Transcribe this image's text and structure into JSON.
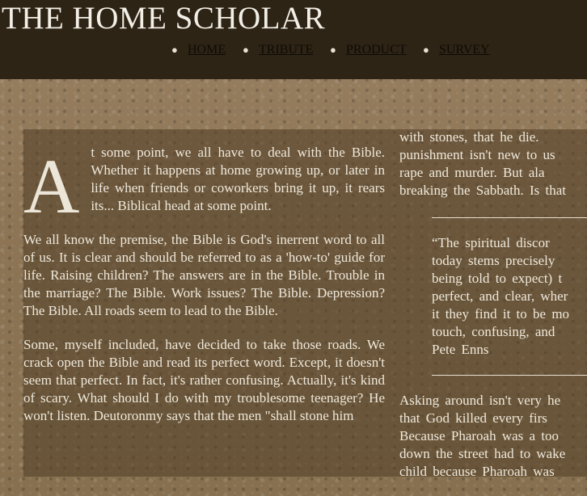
{
  "site": {
    "title": "THE HOME SCHOLAR"
  },
  "nav": [
    {
      "label": "HOME"
    },
    {
      "label": "TRIBUTE"
    },
    {
      "label": "PRODUCT"
    },
    {
      "label": "SURVEY"
    }
  ],
  "article": {
    "dropcap": "A",
    "para1": "t some point, we all have to deal with the Bible. Whether it happens at home growing up, or later in life when friends or coworkers bring it up, it rears its... Biblical head at some point.",
    "para2": "We all know the premise, the Bible is God's inerrent word to all of us. It is clear and should be referred to as a 'how-to' guide for life. Raising children? The answers are in the Bible. Trouble in the marriage? The Bible. Work issues? The Bible. Depression? The Bible. All roads seem to lead to the Bible.",
    "para3": "Some, myself included, have decided to take those roads. We crack open the Bible and read its perfect word. Except, it doesn't seem that perfect. In fact, it's rather confusing. Actually, it's kind of scary. What should I do with my troublesome teenager? He won't listen. Deutoronmy says that the men \"shall stone him",
    "col2_lines": [
      "with stones, that he die.",
      "punishment isn't new to us",
      "rape and murder. But ala",
      "breaking the Sabbath. Is that"
    ],
    "quote_lines": [
      "“The spiritual discor",
      "today stems precisely",
      "being told to expect) t",
      "perfect, and clear, wher",
      "it they find it to be mo",
      "touch, confusing, and",
      "Pete Enns"
    ],
    "col2_after_lines": [
      "Asking around isn't very he",
      "that God killed every firs",
      "Because Pharoah was a too",
      "down the street had to wake",
      "child because Pharoah was"
    ]
  }
}
